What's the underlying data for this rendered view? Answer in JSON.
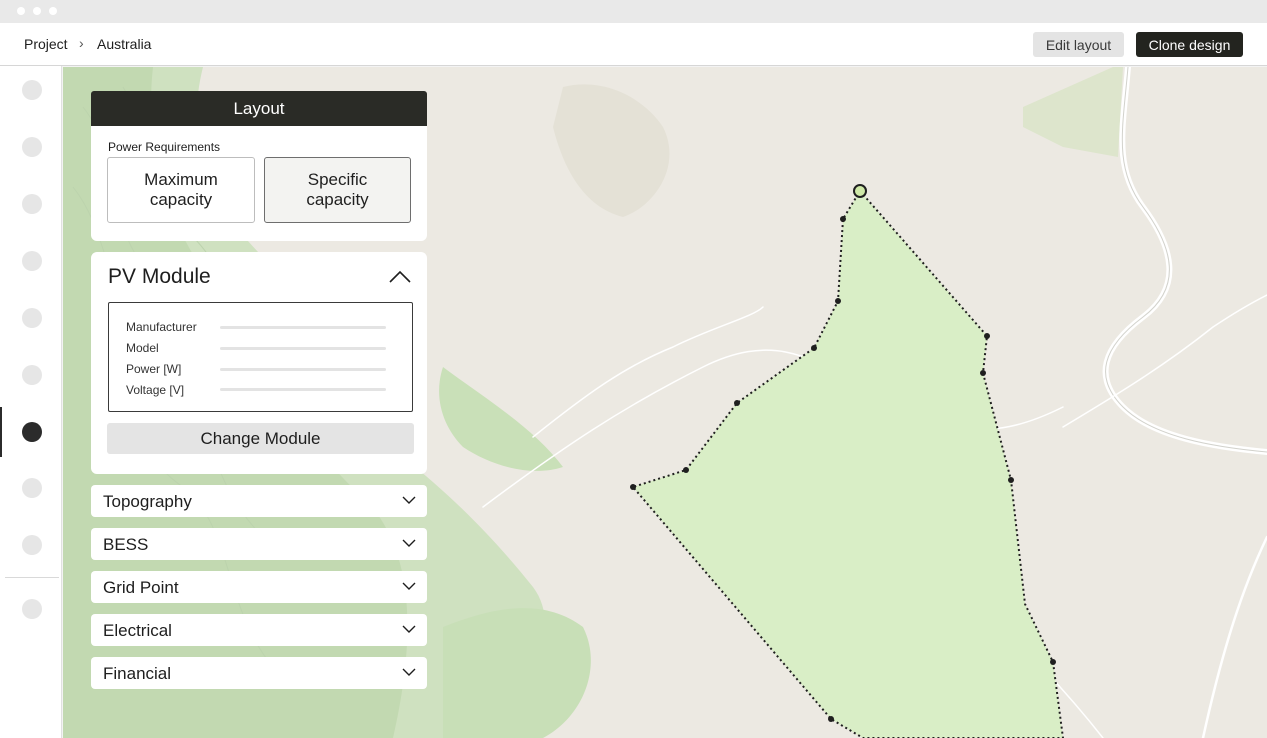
{
  "breadcrumb": {
    "project": "Project",
    "separator": "›",
    "current": "Australia"
  },
  "header_actions": {
    "edit_label": "Edit layout",
    "clone_label": "Clone design"
  },
  "rail": {
    "item_count": 10,
    "active_index": 6
  },
  "panel": {
    "title": "Layout",
    "power": {
      "title": "Power Requirements",
      "options": [
        {
          "label": "Maximum capacity",
          "selected": false
        },
        {
          "label": "Specific capacity",
          "selected": true
        }
      ]
    },
    "pv_module": {
      "title": "PV Module",
      "fields": [
        "Manufacturer",
        "Model",
        "Power [W]",
        "Voltage [V]"
      ],
      "change_label": "Change Module"
    },
    "sections": [
      "Topography",
      "BESS",
      "Grid Point",
      "Electrical",
      "Financial"
    ]
  },
  "colors": {
    "accent_dark": "#2a2b26",
    "site_fill": "#d9eec6",
    "vegetation": "#cfe5c0",
    "map_base": "#ece9e2"
  },
  "icons": {
    "collapse": "chevron-up-icon",
    "expand": "chevron-down-icon"
  }
}
